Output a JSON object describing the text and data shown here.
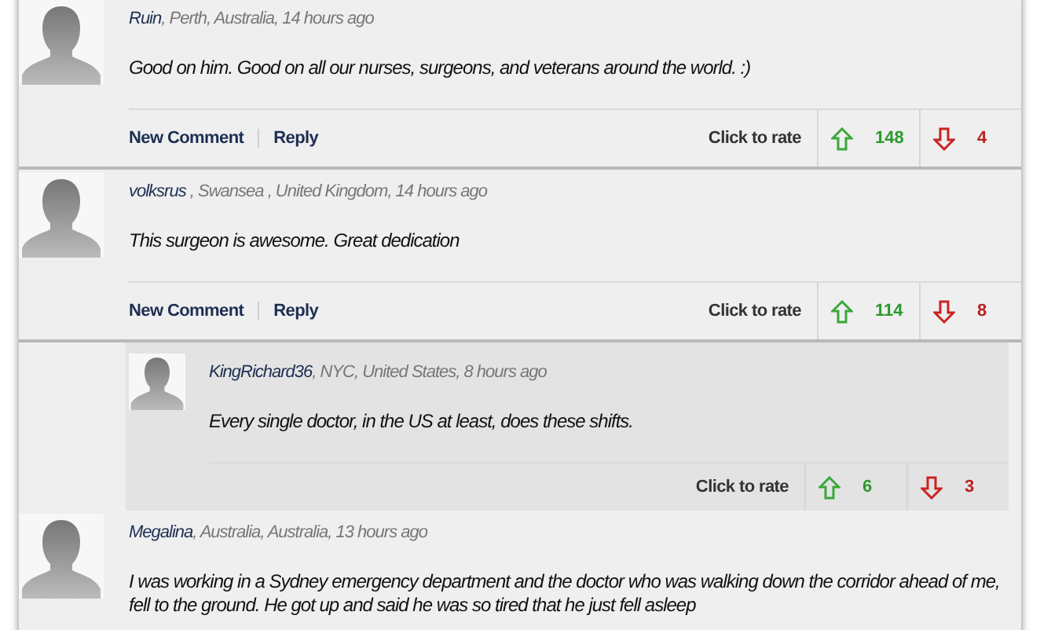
{
  "comments": [
    {
      "author": "Ruin",
      "meta": ", Perth, Australia, 14 hours ago",
      "text": "Good on him. Good on all our nurses, surgeons, and veterans around the world. :)",
      "actions": [
        "New Comment",
        "Reply"
      ],
      "rate_label": "Click to rate",
      "up": "148",
      "down": "4"
    },
    {
      "author": "volksrus",
      "meta": " , Swansea , United Kingdom, 14 hours ago",
      "text": "This surgeon is awesome. Great dedication",
      "actions": [
        "New Comment",
        "Reply"
      ],
      "rate_label": "Click to rate",
      "up": "114",
      "down": "8",
      "replies": [
        {
          "author": "KingRichard36",
          "meta": ", NYC, United States, 8 hours ago",
          "text": "Every single doctor, in the US at least, does these shifts.",
          "rate_label": "Click to rate",
          "up": "6",
          "down": "3"
        }
      ]
    },
    {
      "author": "Megalina",
      "meta": ", Australia, Australia, 13 hours ago",
      "text": "I was working in a Sydney emergency department and the doctor who was walking down the corridor ahead of me, fell to the ground. He got up and said he was so tired that he just fell asleep"
    }
  ]
}
